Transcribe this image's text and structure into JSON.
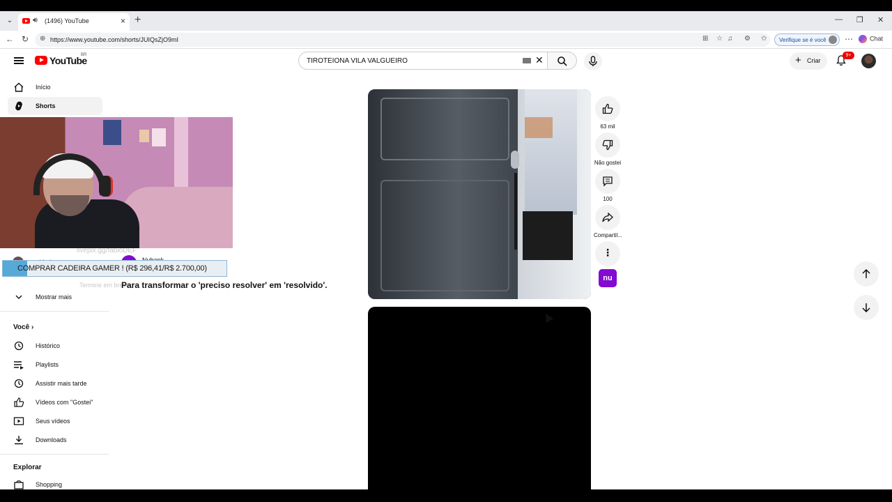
{
  "browser": {
    "tab_title": "(1496) YouTube",
    "url": "https://www.youtube.com/shorts/JUIQsZjO9mI",
    "verify_label": "Verifique se é você",
    "chat_label": "Chat"
  },
  "header": {
    "logo_text": "YouTube",
    "country": "BR",
    "search_query": "TIROTEIONA VILA VALGUEIRO",
    "create_label": "Criar",
    "notifications": "9+"
  },
  "sidebar": {
    "items": [
      {
        "label": "Início",
        "icon": "home-icon"
      },
      {
        "label": "Shorts",
        "icon": "shorts-icon"
      }
    ],
    "subscription": "whinderssonnu",
    "show_more": "Mostrar mais",
    "you_heading": "Você",
    "you_items": [
      {
        "label": "Histórico",
        "icon": "history-icon"
      },
      {
        "label": "Playlists",
        "icon": "playlists-icon"
      },
      {
        "label": "Assistir mais tarde",
        "icon": "watch-later-icon"
      },
      {
        "label": "Vídeos com \"Gostei\"",
        "icon": "like-icon"
      },
      {
        "label": "Seus vídeos",
        "icon": "your-videos-icon"
      },
      {
        "label": "Downloads",
        "icon": "download-icon"
      }
    ],
    "explore_heading": "Explorar",
    "explore_items": [
      {
        "label": "Shopping",
        "icon": "shopping-icon"
      }
    ]
  },
  "short": {
    "channel": "Nubank",
    "title": "Para transformar o 'preciso resolver' em 'resolvido'.",
    "faint_top": "livepix.gg/fabioDEF",
    "faint_bottom": "Termine em breve"
  },
  "overlay": {
    "promo": "COMPRAR CADEIRA GAMER ! (R$ 296,41/R$ 2.700,00)"
  },
  "actions": {
    "likes": "63 mil",
    "dislike_label": "Não gostei",
    "comments": "100",
    "share_label": "Compartil...",
    "sponsor_badge": "nu"
  }
}
